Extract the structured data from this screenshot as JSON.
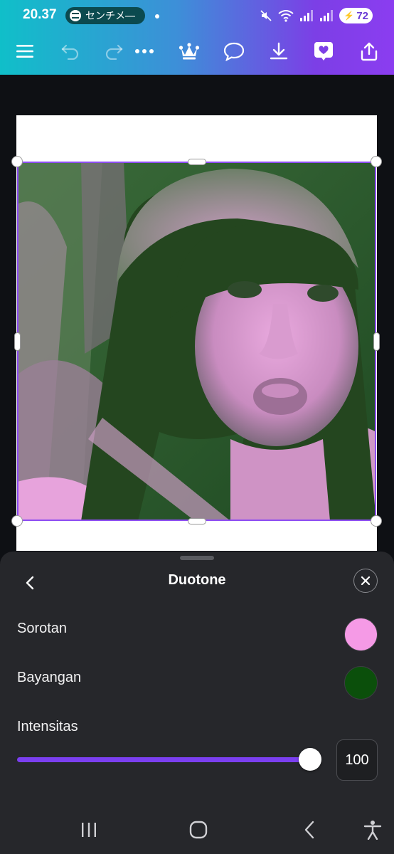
{
  "status_bar": {
    "time": "20.37",
    "media_label": "センチメ―",
    "battery": "72"
  },
  "toolbar": {
    "icons": [
      "menu-icon",
      "undo-icon",
      "redo-icon",
      "more-icon",
      "crown-icon",
      "comment-icon",
      "download-icon",
      "heart-icon",
      "share-icon"
    ]
  },
  "colors": {
    "highlight": "#f59ae6",
    "shadow": "#0b4f0b",
    "accent": "#7b3ff0"
  },
  "panel": {
    "title": "Duotone",
    "highlight_label": "Sorotan",
    "shadow_label": "Bayangan",
    "intensity_label": "Intensitas",
    "intensity_value": "100"
  },
  "nav_bar": {
    "icons": [
      "recents-icon",
      "home-icon",
      "back-icon",
      "accessibility-icon"
    ]
  }
}
